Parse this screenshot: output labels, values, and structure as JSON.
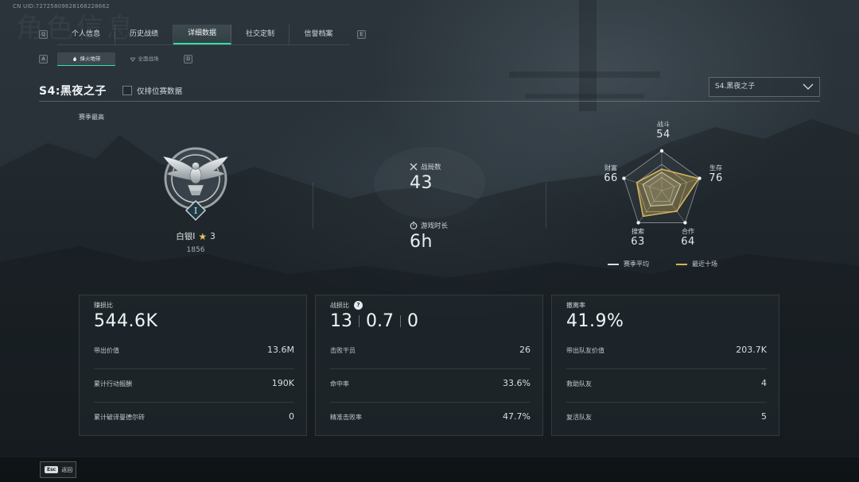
{
  "uid": "CN UID:7272580962816822866​2",
  "ghost_title": "角色信息",
  "key_hints": {
    "left_tabs": "Q",
    "right_tabs": "E",
    "left_sub": "A",
    "right_sub": "D"
  },
  "tabs": [
    {
      "label": "个人信息",
      "active": false
    },
    {
      "label": "历史战绩",
      "active": false
    },
    {
      "label": "详细数据",
      "active": true
    },
    {
      "label": "社交定制",
      "active": false
    },
    {
      "label": "信誉档案",
      "active": false
    }
  ],
  "subtabs": [
    {
      "label": "烽火地带",
      "active": true,
      "icon": "flame-icon"
    },
    {
      "label": "全面战场",
      "active": false,
      "icon": "battlefield-icon"
    }
  ],
  "season_title": "S4:黑夜之子",
  "rank_only_label": "仅排位赛数据",
  "season_select": {
    "value": "S4.黑夜之子"
  },
  "season_best_label": "赛季最高",
  "rank": {
    "name": "白银I",
    "stars": "3",
    "score": "1856",
    "numeral": "I"
  },
  "mid_stats": {
    "matches_label": "战局数",
    "matches_value": "43",
    "playtime_label": "游戏时长",
    "playtime_value": "6h"
  },
  "radar": {
    "axes": [
      {
        "name": "战斗",
        "value": "54"
      },
      {
        "name": "生存",
        "value": "76"
      },
      {
        "name": "合作",
        "value": "64"
      },
      {
        "name": "搜索",
        "value": "63"
      },
      {
        "name": "财富",
        "value": "66"
      }
    ],
    "season_avg": [
      0.46,
      0.5,
      0.44,
      0.48,
      0.5
    ],
    "recent": [
      0.54,
      0.98,
      0.64,
      0.8,
      0.66
    ],
    "legend_avg": "赛季平均",
    "legend_recent": "最近十场",
    "avg_color": "#d8dde0",
    "recent_color": "#d3b45a"
  },
  "cards": [
    {
      "head_label": "赚损比",
      "big": "544.6K",
      "rows": [
        {
          "k": "带出价值",
          "v": "13.6M"
        },
        {
          "k": "累计行动报酬",
          "v": "190K"
        },
        {
          "k": "累计破译曼德尔砖",
          "v": "0"
        }
      ]
    },
    {
      "head_label": "战损比",
      "big_parts": [
        "13",
        "0.7",
        "0"
      ],
      "rows": [
        {
          "k": "击败干员",
          "v": "26"
        },
        {
          "k": "命中率",
          "v": "33.6%"
        },
        {
          "k": "精准击败率",
          "v": "47.7%"
        }
      ]
    },
    {
      "head_label": "撤离率",
      "big": "41.9%",
      "rows": [
        {
          "k": "带出队友价值",
          "v": "203.7K"
        },
        {
          "k": "救助队友",
          "v": "4"
        },
        {
          "k": "复活队友",
          "v": "5"
        }
      ]
    }
  ],
  "footer": {
    "esc_key": "Esc",
    "esc_label": "返回"
  },
  "colors": {
    "accent": "#33e0a6",
    "gold": "#d3b45a"
  }
}
